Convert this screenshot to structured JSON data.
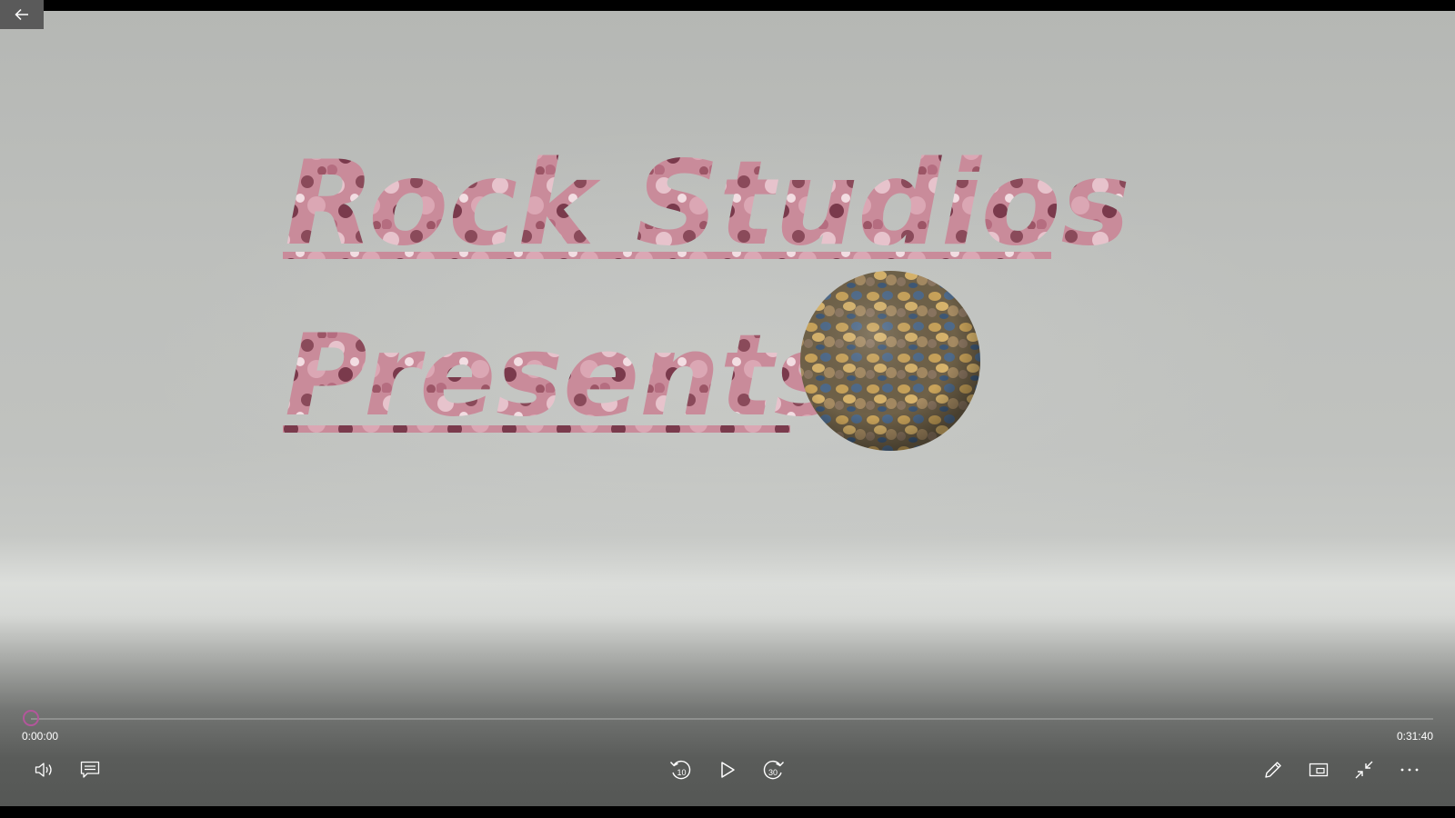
{
  "player": {
    "back_icon": "arrow-left-icon",
    "accent_color": "#b3569b"
  },
  "video": {
    "title_line1": "Rock Studios",
    "title_line2": "Presents"
  },
  "timeline": {
    "current_time": "0:00:00",
    "total_time": "0:31:40",
    "progress": 0.0
  },
  "controls": {
    "left": [
      {
        "name": "volume-icon"
      },
      {
        "name": "subtitles-icon"
      }
    ],
    "center": [
      {
        "name": "skip-back-10-icon",
        "label": "10"
      },
      {
        "name": "play-icon"
      },
      {
        "name": "skip-forward-30-icon",
        "label": "30"
      }
    ],
    "right": [
      {
        "name": "edit-pen-icon"
      },
      {
        "name": "mini-view-icon"
      },
      {
        "name": "exit-fullscreen-icon"
      },
      {
        "name": "more-options-icon"
      }
    ]
  }
}
